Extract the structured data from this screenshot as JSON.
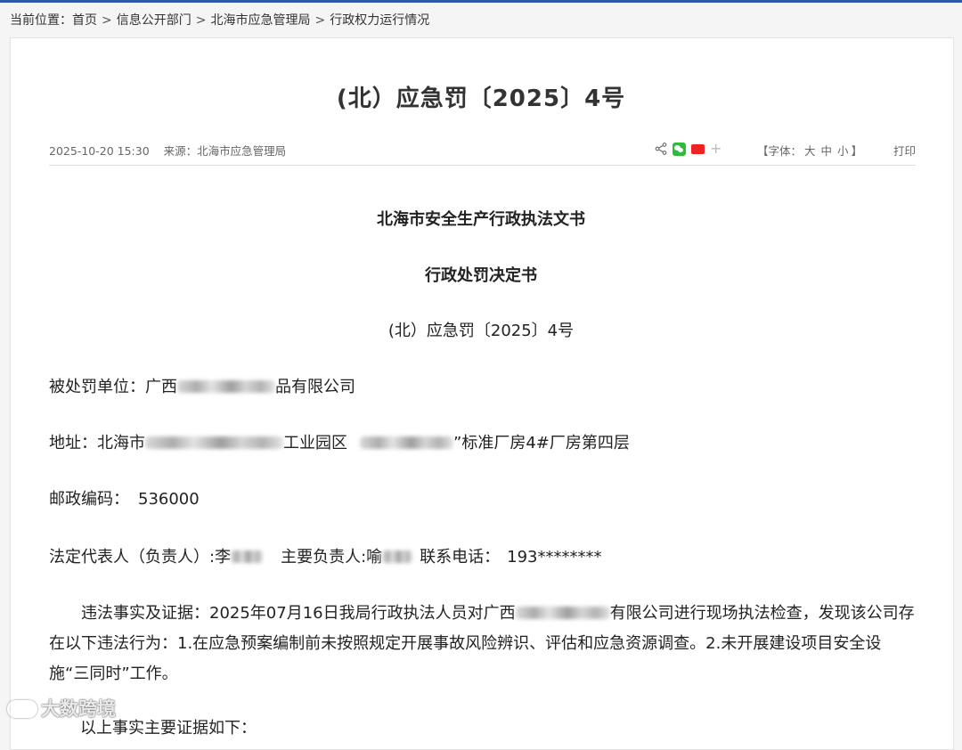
{
  "breadcrumb": {
    "prefix": "当前位置：",
    "items": [
      "首页",
      "信息公开部门",
      "北海市应急管理局",
      "行政权力运行情况"
    ],
    "separator": ">"
  },
  "article": {
    "title": "(北）应急罚〔2025〕4号",
    "datetime": "2025-10-20 15:30",
    "source": "来源：北海市应急管理局",
    "font_size": {
      "label": "【字体：",
      "large": "大",
      "medium": "中",
      "small": "小",
      "close": "】"
    },
    "print": "打印"
  },
  "document": {
    "header1": "北海市安全生产行政执法文书",
    "header2": "行政处罚决定书",
    "doc_number": "(北）应急罚〔2025〕4号",
    "penalized_label": "被处罚单位：",
    "penalized_prefix": "广西",
    "penalized_suffix": "品有限公司",
    "address_label": "地址：",
    "address_p1": "北海市",
    "address_p2": "工业园区",
    "address_p3": "”标准厂房4#厂房第四层",
    "postal_label": "邮政编码：",
    "postal_value": "536000",
    "legal_rep_label": "法定代表人（负责人）:李",
    "main_person_label": "主要负责人:喻",
    "phone_label": "联系电话：",
    "phone_value": "193********",
    "fact_p1": "违法事实及证据：2025年07月16日我局行政执法人员对广西",
    "fact_p2": "有限公司进行现场执法检查，发现该公司存在以下违法行为：1.在应急预案编制前未按照规定开展事故风险辨识、评估和应急资源调查。2.未开展建设项目安全设施“三同时”工作。",
    "cutoff_line": "以上事实主要证据如下："
  },
  "watermark": "大数跨境",
  "colors": {
    "topbar": "#2f5aa8",
    "wechat": "#2dbb3a",
    "weibo": "#ee2222"
  },
  "icons": [
    "share-icon",
    "wechat-icon",
    "weibo-icon",
    "plus-icon"
  ]
}
